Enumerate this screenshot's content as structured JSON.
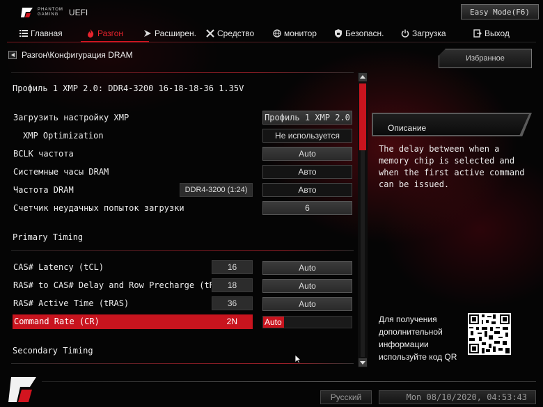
{
  "header": {
    "logo_line1": "PHANTOM",
    "logo_line2": "GAMING",
    "logo_uefi": "UEFI",
    "easy_mode": "Easy Mode(F6)"
  },
  "menu": {
    "items": [
      {
        "label": "Главная",
        "icon": "list-icon"
      },
      {
        "label": "Разгон",
        "icon": "flame-icon"
      },
      {
        "label": "Расширен.",
        "icon": "arrow-icon"
      },
      {
        "label": "Средство",
        "icon": "tools-icon"
      },
      {
        "label": "монитор",
        "icon": "globe-icon"
      },
      {
        "label": "Безопасн.",
        "icon": "shield-icon"
      },
      {
        "label": "Загрузка",
        "icon": "power-icon"
      },
      {
        "label": "Выход",
        "icon": "exit-icon"
      }
    ],
    "active_index": 1
  },
  "breadcrumb": "Разгон\\Конфигурация DRAM",
  "favorites": "Избранное",
  "profile_text": "Профиль 1 XMP 2.0: DDR4-3200 16-18-18-36 1.35V",
  "settings": [
    {
      "label": "Загрузить настройку XMP",
      "value": "Профиль 1 XMP 2.0"
    },
    {
      "label": "XMP Optimization",
      "value": "Не используется"
    },
    {
      "label": "BCLK частота",
      "value": "Auto"
    },
    {
      "label": "Системные часы DRAM",
      "value": "Авто"
    },
    {
      "label": "Частота DRAM",
      "info": "DDR4-3200 (1:24)",
      "value": "Авто"
    },
    {
      "label": "Счетчик неудачных попыток загрузки",
      "value": "6"
    }
  ],
  "primary_timing": {
    "title": "Primary Timing",
    "rows": [
      {
        "label": "CAS# Latency (tCL)",
        "current": "16",
        "value": "Auto"
      },
      {
        "label": "RAS# to CAS# Delay and Row Precharge (tRCDtRP)",
        "current": "18",
        "value": "Auto"
      },
      {
        "label": "RAS# Active Time (tRAS)",
        "current": "36",
        "value": "Auto"
      },
      {
        "label": "Command Rate (CR)",
        "current": "2N",
        "value": "Auto"
      }
    ]
  },
  "secondary_timing": {
    "title": "Secondary Timing"
  },
  "description": {
    "title": "Описание",
    "text": "The delay between when a memory chip is selected and when the first active command can be issued."
  },
  "qr": {
    "text": "Для получения дополнительной информации используйте код QR"
  },
  "footer": {
    "language": "Русский",
    "datetime": "Mon 08/10/2020, 04:53:43"
  },
  "colors": {
    "accent": "#c8141e",
    "active_menu": "#e8232d"
  }
}
